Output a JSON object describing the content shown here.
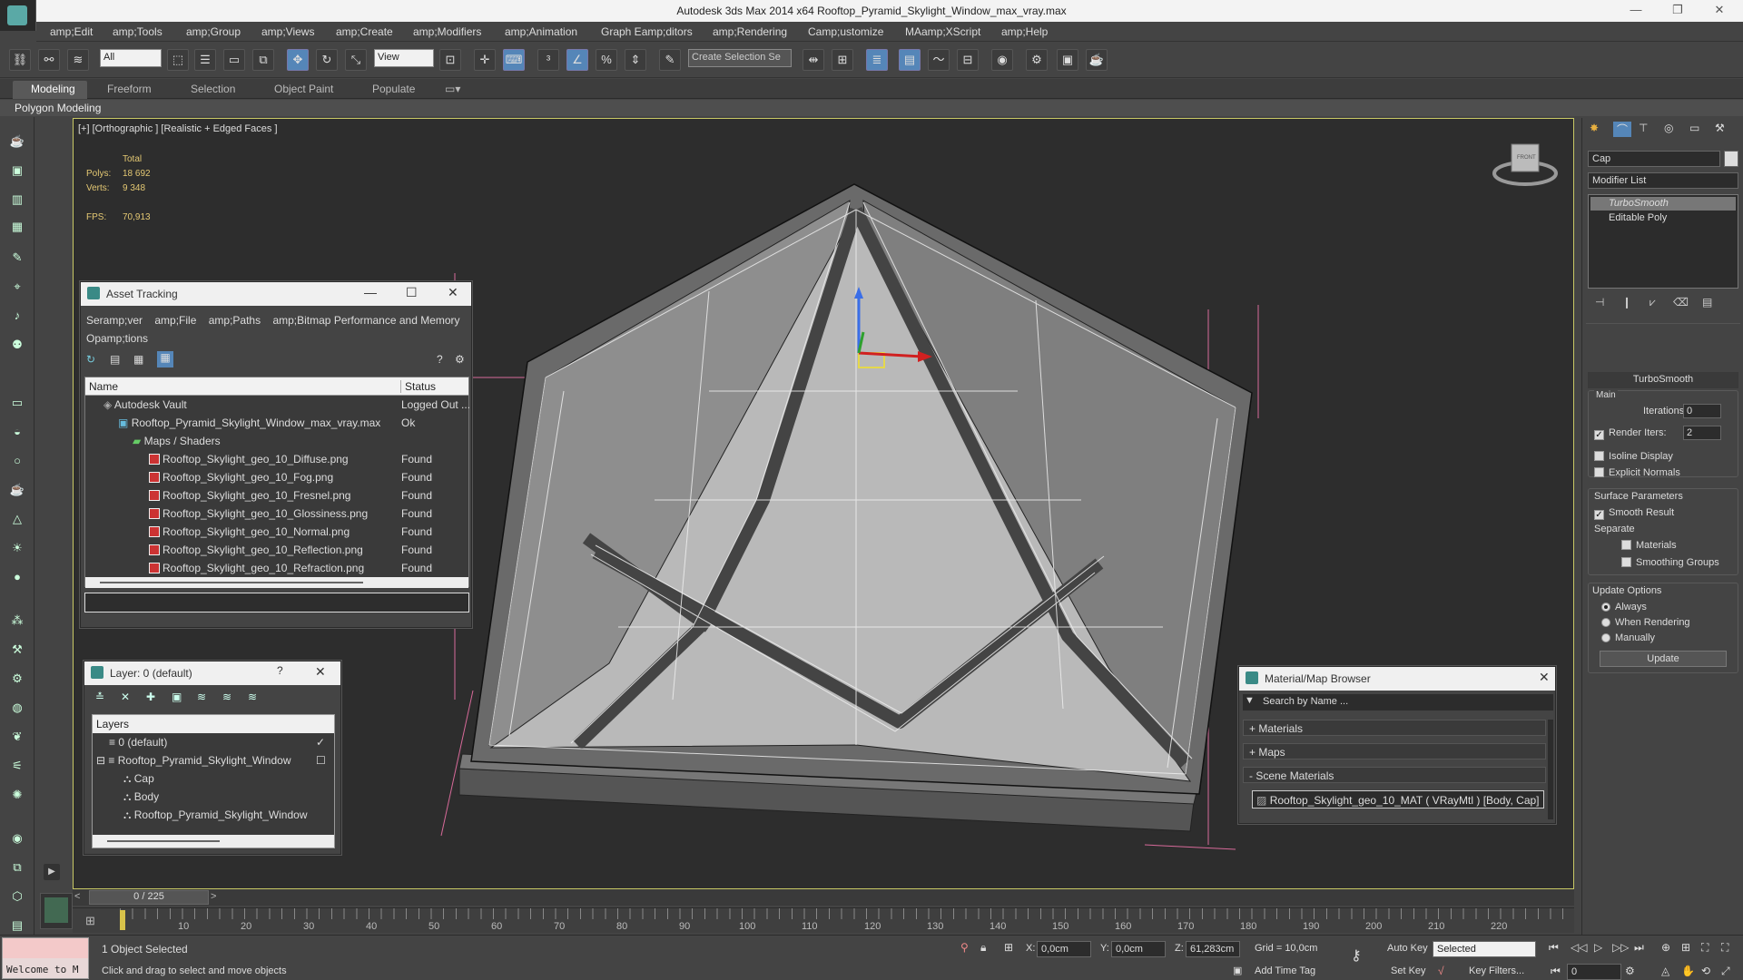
{
  "window": {
    "title": "Autodesk 3ds Max  2014 x64     Rooftop_Pyramid_Skylight_Window_max_vray.max"
  },
  "menu": [
    "amp;Edit",
    "amp;Tools",
    "amp;Group",
    "amp;Views",
    "amp;Create",
    "amp;Modifiers",
    "amp;Animation",
    "Graph Eamp;ditors",
    "amp;Rendering",
    "Camp;ustomize",
    "MAamp;XScript",
    "amp;Help"
  ],
  "toolbar": {
    "selection_filter": "All",
    "ref_coord": "View",
    "named_selection": "Create Selection Se"
  },
  "ribbon": {
    "tabs": [
      "Modeling",
      "Freeform",
      "Selection",
      "Object Paint",
      "Populate"
    ],
    "panel_label": "Polygon Modeling"
  },
  "viewport": {
    "label": "[+] [Orthographic ] [Realistic + Edged Faces ]",
    "stats": {
      "total_label": "Total",
      "polys_label": "Polys:",
      "polys_value": "18 692",
      "verts_label": "Verts:",
      "verts_value": "9 348",
      "fps_label": "FPS:",
      "fps_value": "70,913"
    },
    "viewcube_label": "FRONT"
  },
  "asset_tracking": {
    "title": "Asset Tracking",
    "menu": [
      "Seramp;ver",
      "amp;File",
      "amp;Paths",
      "amp;Bitmap Performance and Memory",
      "Opamp;tions"
    ],
    "col_name": "Name",
    "col_status": "Status",
    "rows": [
      {
        "name": "Autodesk Vault",
        "status": "Logged Out ..."
      },
      {
        "name": "Rooftop_Pyramid_Skylight_Window_max_vray.max",
        "status": "Ok"
      },
      {
        "name": "Maps / Shaders",
        "status": ""
      },
      {
        "name": "Rooftop_Skylight_geo_10_Diffuse.png",
        "status": "Found"
      },
      {
        "name": "Rooftop_Skylight_geo_10_Fog.png",
        "status": "Found"
      },
      {
        "name": "Rooftop_Skylight_geo_10_Fresnel.png",
        "status": "Found"
      },
      {
        "name": "Rooftop_Skylight_geo_10_Glossiness.png",
        "status": "Found"
      },
      {
        "name": "Rooftop_Skylight_geo_10_Normal.png",
        "status": "Found"
      },
      {
        "name": "Rooftop_Skylight_geo_10_Reflection.png",
        "status": "Found"
      },
      {
        "name": "Rooftop_Skylight_geo_10_Refraction.png",
        "status": "Found"
      }
    ]
  },
  "layer_panel": {
    "title": "Layer: 0 (default)",
    "help": "?",
    "header": "Layers",
    "items": [
      "0 (default)",
      "Rooftop_Pyramid_Skylight_Window",
      "Cap",
      "Body",
      "Rooftop_Pyramid_Skylight_Window"
    ]
  },
  "material_browser": {
    "title": "Material/Map Browser",
    "search_placeholder": "Search by Name ...",
    "sections": [
      "+ Materials",
      "+ Maps",
      "- Scene Materials"
    ],
    "scene_material": "Rooftop_Skylight_geo_10_MAT ( VRayMtl ) [Body, Cap]"
  },
  "command_panel": {
    "object_name": "Cap",
    "modifier_list": "Modifier List",
    "stack": [
      "TurboSmooth",
      "Editable Poly"
    ],
    "rollout_title": "TurboSmooth",
    "main_label": "Main",
    "iterations_label": "Iterations:",
    "iterations_value": "0",
    "render_iters_label": "Render Iters:",
    "render_iters_value": "2",
    "isoline_label": "Isoline Display",
    "explicit_normals_label": "Explicit Normals",
    "surface_params_label": "Surface Parameters",
    "smooth_result_label": "Smooth Result",
    "separate_label": "Separate",
    "materials_label": "Materials",
    "smoothing_groups_label": "Smoothing Groups",
    "update_options_label": "Update Options",
    "always_label": "Always",
    "when_rendering_label": "When Rendering",
    "manually_label": "Manually",
    "update_button": "Update"
  },
  "timeline": {
    "frame_display": "0 / 225",
    "ticks": [
      "10",
      "20",
      "30",
      "40",
      "50",
      "60",
      "70",
      "80",
      "90",
      "100",
      "110",
      "120",
      "130",
      "140",
      "150",
      "160",
      "170",
      "180",
      "190",
      "200",
      "210",
      "220"
    ]
  },
  "status": {
    "selected_text": "1 Object Selected",
    "prompt": "Click and drag to select and move objects",
    "maxscript": "Welcome to M",
    "x_label": "X:",
    "x_value": "0,0cm",
    "y_label": "Y:",
    "y_value": "0,0cm",
    "z_label": "Z:",
    "z_value": "61,283cm",
    "grid": "Grid = 10,0cm",
    "add_time_tag": "Add Time Tag",
    "auto_key": "Auto Key",
    "set_key": "Set Key",
    "selected_dropdown": "Selected",
    "key_filters": "Key Filters...",
    "frame_value": "0"
  }
}
